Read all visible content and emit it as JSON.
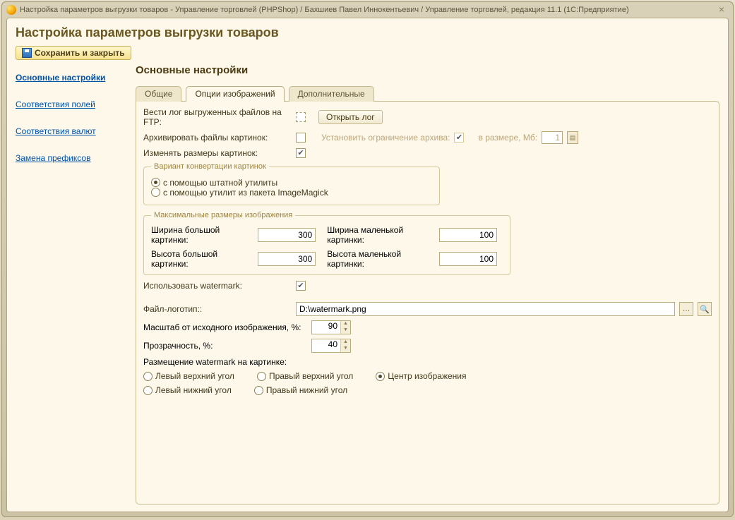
{
  "title": "Настройка параметров выгрузки товаров - Управление торговлей (PHPShop) / Бахшиев Павел Иннокентьевич / Управление торговлей, редакция 11.1  (1С:Предприятие)",
  "page_title": "Настройка параметров выгрузки товаров",
  "toolbar": {
    "save_close": "Сохранить и закрыть"
  },
  "sidebar": {
    "items": [
      "Основные настройки",
      "Соответствия полей",
      "Соответствия валют",
      "Замена префиксов"
    ],
    "active_index": 0
  },
  "section_title": "Основные настройки",
  "tabs": {
    "labels": [
      "Общие",
      "Опции изображений",
      "Дополнительные"
    ],
    "active_index": 1
  },
  "ftp_log": {
    "label": "Вести лог выгруженных файлов на FTP:",
    "open_btn": "Открыть лог"
  },
  "archive": {
    "label": "Архивировать файлы картинок:",
    "limit_label": "Установить ограничение архива:",
    "size_label": "в размере, Мб:",
    "size_value": "1"
  },
  "resize": {
    "label": "Изменять размеры картинок:",
    "checked": true
  },
  "convert": {
    "legend": "Вариант конвертации картинок",
    "option_native": "с помощью штатной утилиты",
    "option_imagick": "с помощью утилит из пакета ImageMagick",
    "selected": 0
  },
  "maxsize": {
    "legend": "Максимальные размеры изображения",
    "width_big_label": "Ширина большой картинки:",
    "width_big": "300",
    "width_small_label": "Ширина маленькой картинки:",
    "width_small": "100",
    "height_big_label": "Высота большой картинки:",
    "height_big": "300",
    "height_small_label": "Высота маленькой картинки:",
    "height_small": "100"
  },
  "watermark": {
    "label": "Использовать watermark:",
    "checked": true
  },
  "logo": {
    "label": "Файл-логотип::",
    "path": "D:\\watermark.png"
  },
  "scale": {
    "label": "Масштаб от исходного изображения, %:",
    "value": "90"
  },
  "opacity": {
    "label": "Прозрачность, %:",
    "value": "40"
  },
  "placement": {
    "label": "Размещение watermark на картинке:",
    "options": [
      "Левый верхний угол",
      "Правый верхний угол",
      "Центр изображения",
      "Левый нижний угол",
      "Правый нижний угол"
    ],
    "selected": 2
  }
}
